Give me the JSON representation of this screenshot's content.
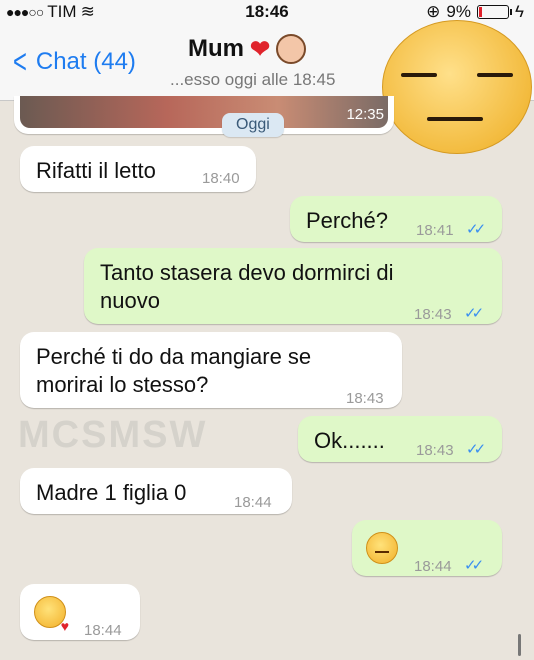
{
  "status": {
    "carrier": "TIM",
    "time": "18:46",
    "battery": "9%"
  },
  "nav": {
    "back_label": "Chat (44)",
    "contact_name": "Mum",
    "subtitle": "...esso oggi alle 18:45"
  },
  "chat": {
    "photo_time": "12:35",
    "day_separator": "Oggi",
    "messages": [
      {
        "dir": "in",
        "text": "Rifatti il letto",
        "time": "18:40"
      },
      {
        "dir": "out",
        "text": "Perché?",
        "time": "18:41"
      },
      {
        "dir": "out",
        "text_line1": "Tanto stasera devo dormirci di",
        "text_line2": "nuovo",
        "time": "18:43"
      },
      {
        "dir": "in",
        "text_line1": "Perché ti do da mangiare se",
        "text_line2": "morirai lo stesso?",
        "time": "18:43"
      },
      {
        "dir": "out",
        "text": "Ok.......",
        "time": "18:43"
      },
      {
        "dir": "in",
        "text": "Madre 1 figlia 0",
        "time": "18:44"
      },
      {
        "dir": "out",
        "emoji": "unamused-face-icon",
        "time": "18:44"
      },
      {
        "dir": "in",
        "emoji": "kissing-face-icon",
        "time": "18:44"
      }
    ]
  },
  "watermark": "MCSMSW",
  "colors": {
    "accent": "#1e7cf0",
    "incoming": "#ffffff",
    "outgoing": "#dff8c8",
    "read_tick": "#3b8ff0"
  }
}
